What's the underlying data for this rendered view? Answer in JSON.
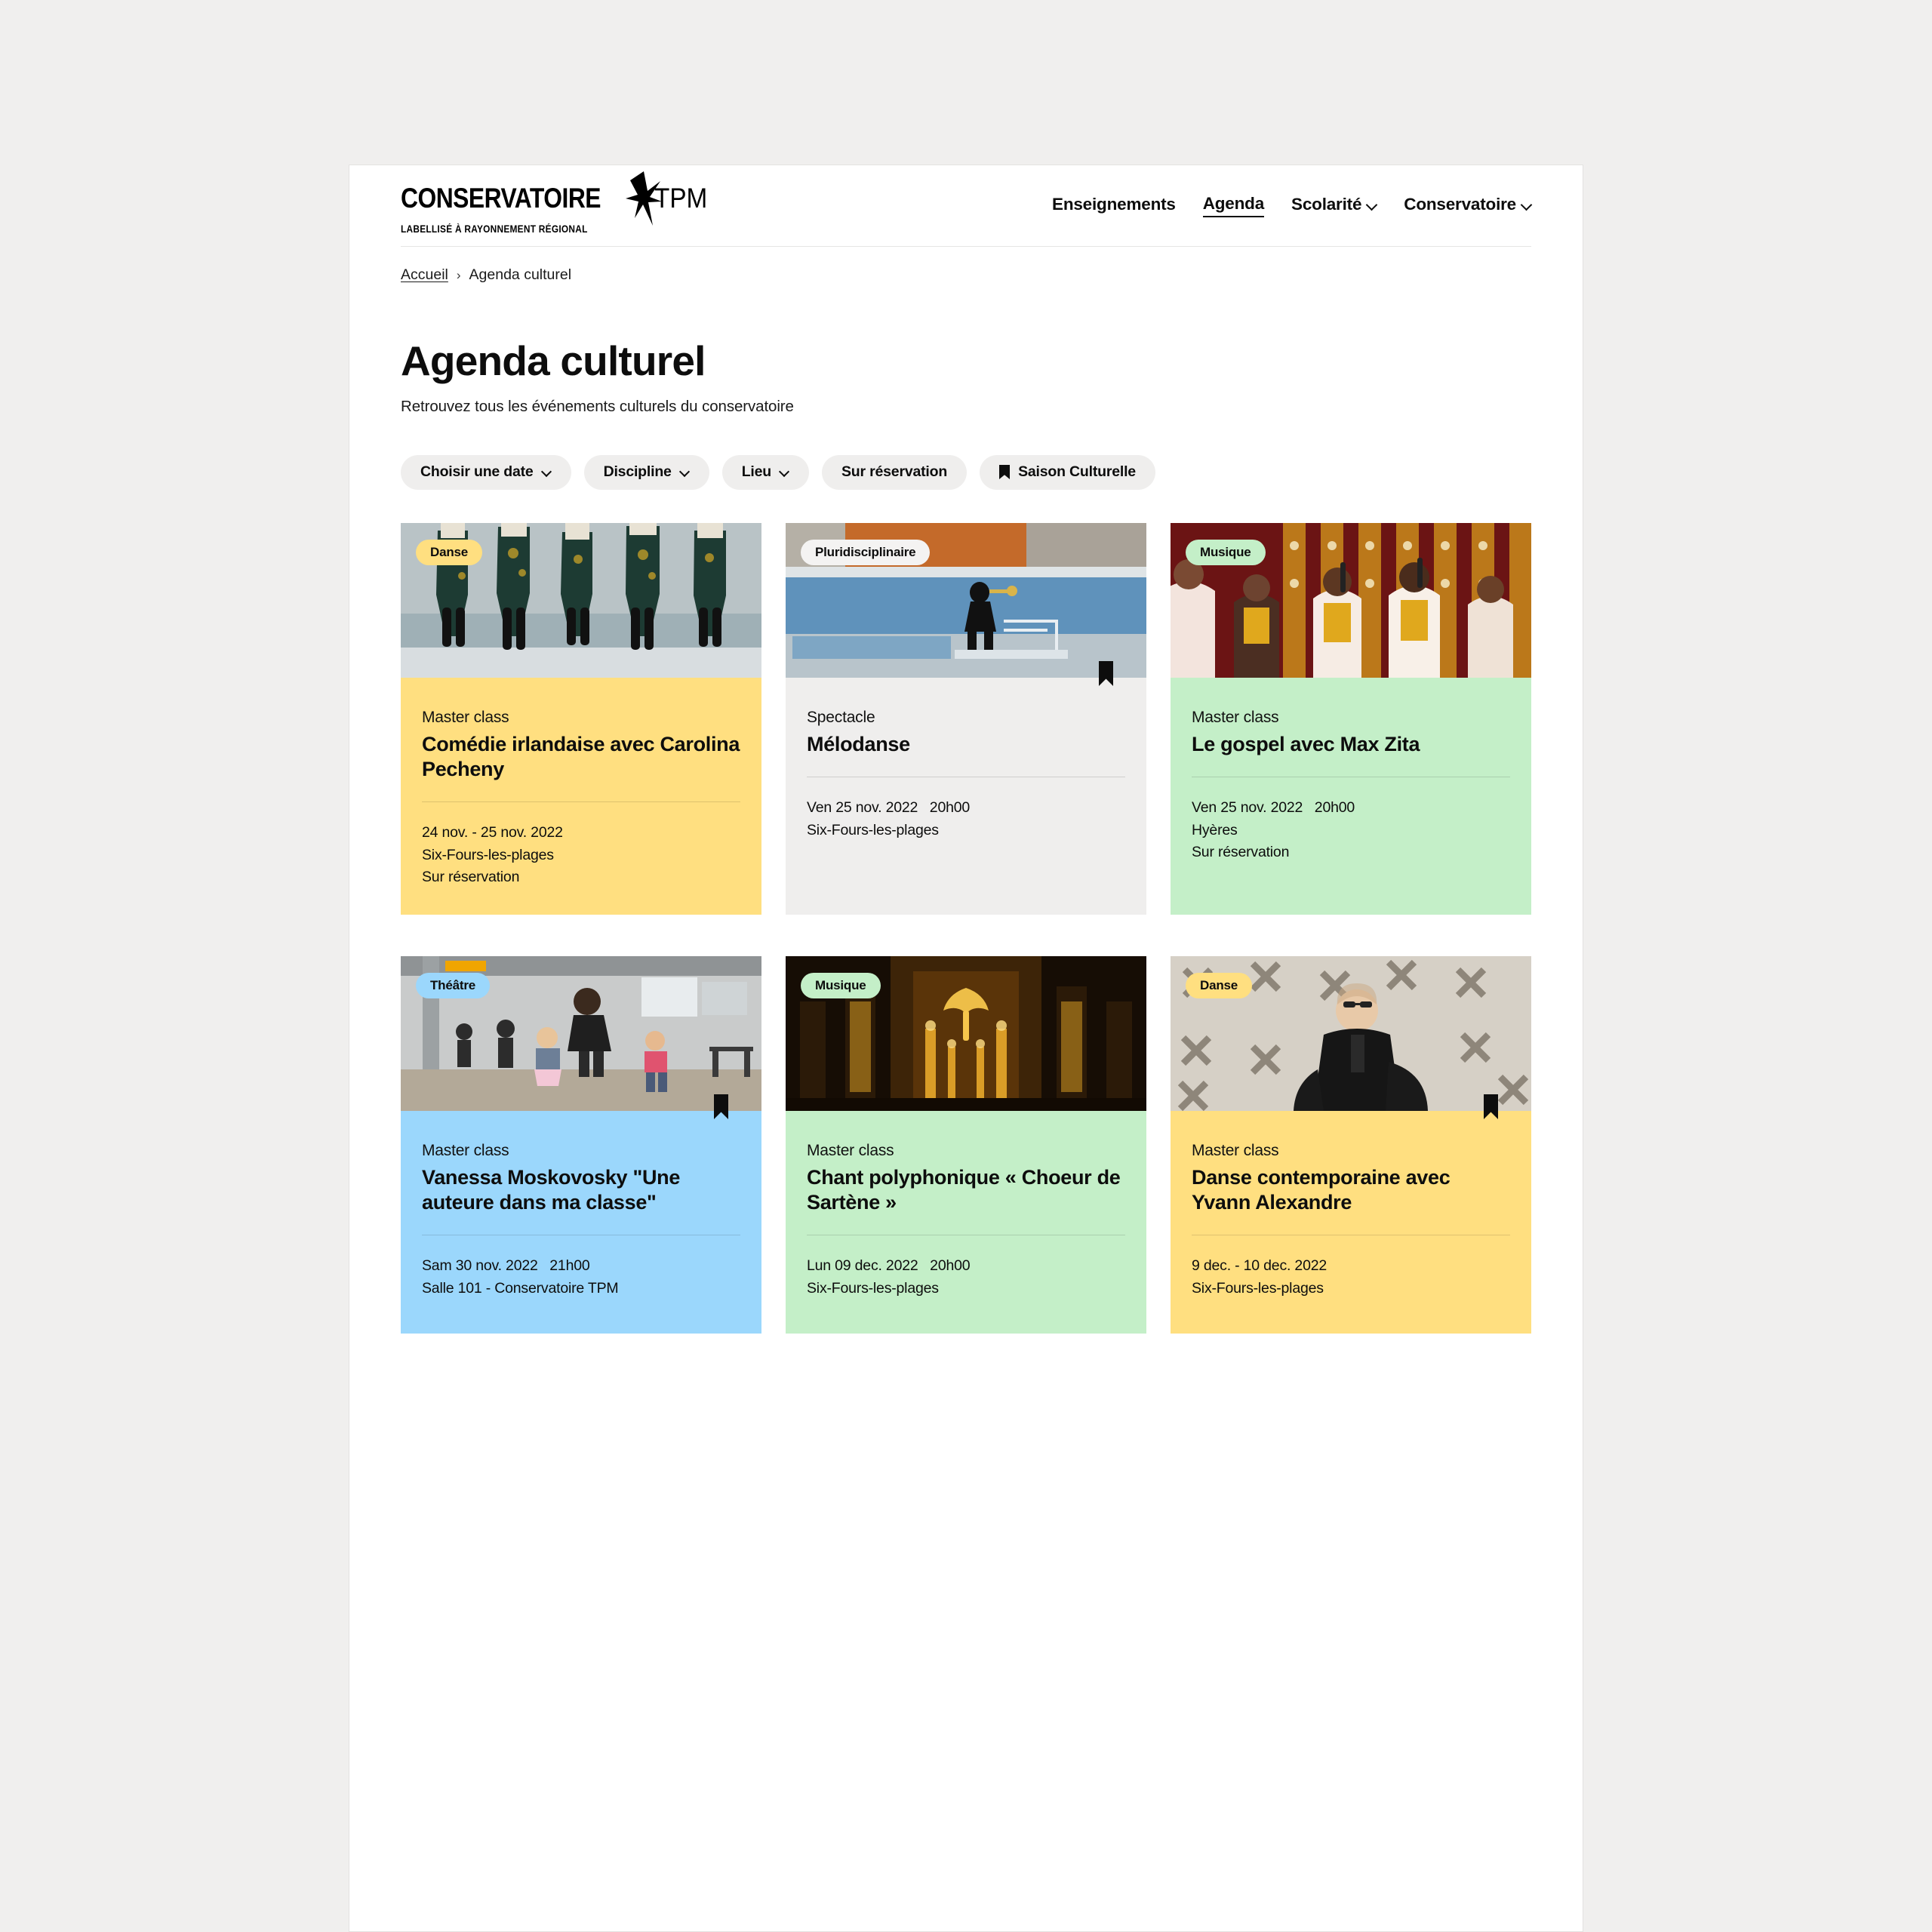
{
  "site": {
    "logo_main": "CONSERVATOIRE",
    "logo_tpm": "TPM",
    "logo_tagline": "LABELLISÉ À RAYONNEMENT RÉGIONAL",
    "logo_star_icon": "star-icon"
  },
  "nav": {
    "items": [
      {
        "label": "Enseignements",
        "has_chevron": false,
        "active": false
      },
      {
        "label": "Agenda",
        "has_chevron": false,
        "active": true
      },
      {
        "label": "Scolarité",
        "has_chevron": true,
        "active": false
      },
      {
        "label": "Conservatoire",
        "has_chevron": true,
        "active": false
      }
    ]
  },
  "breadcrumb": {
    "home": "Accueil",
    "separator": "›",
    "current": "Agenda culturel"
  },
  "page": {
    "title": "Agenda culturel",
    "subtitle": "Retrouvez tous les événements culturels du conservatoire"
  },
  "filters": [
    {
      "label": "Choisir une date",
      "chevron": true,
      "icon": null
    },
    {
      "label": "Discipline",
      "chevron": true,
      "icon": null
    },
    {
      "label": "Lieu",
      "chevron": true,
      "icon": null
    },
    {
      "label": "Sur réservation",
      "chevron": false,
      "icon": null
    },
    {
      "label": "Saison Culturelle",
      "chevron": false,
      "icon": "bookmark-icon"
    }
  ],
  "colors": {
    "yellow": "#FFDF80",
    "green": "#C4EFC8",
    "blue": "#9BD7FC",
    "grey": "#EFEEED",
    "white_badge": "#F4F3F2",
    "page_bg": "#F0EFEE",
    "text": "#0D0D0D"
  },
  "events": [
    {
      "badge": "Danse",
      "badge_color": "#FFDF80",
      "body_color": "#FFDF80",
      "kicker": "Master class",
      "title": "Comédie irlandaise avec Carolina Pecheny",
      "date": "24 nov. - 25 nov. 2022",
      "place": "Six-Fours-les-plages",
      "extra": "Sur réservation",
      "bookmarked": false,
      "image": "irish-dancers-photo"
    },
    {
      "badge": "Pluridisciplinaire",
      "badge_color": "#F4F3F2",
      "body_color": "#EFEEED",
      "kicker": "Spectacle",
      "title": "Mélodanse",
      "date": "Ven 25 nov. 2022   20h00",
      "place": "Six-Fours-les-plages",
      "extra": "",
      "bookmarked": true,
      "image": "trumpet-player-pool-photo"
    },
    {
      "badge": "Musique",
      "badge_color": "#C4EFC8",
      "body_color": "#C4EFC8",
      "kicker": "Master class",
      "title": "Le gospel avec Max Zita",
      "date": "Ven 25 nov. 2022   20h00",
      "place": "Hyères",
      "extra": "Sur réservation",
      "bookmarked": false,
      "image": "gospel-choir-photo"
    },
    {
      "badge": "Théâtre",
      "badge_color": "#9BD7FC",
      "body_color": "#9BD7FC",
      "kicker": "Master class",
      "title": "Vanessa Moskovosky \"Une auteure dans ma classe\"",
      "date": "Sam 30 nov. 2022   21h00",
      "place": "Salle 101 - Conservatoire TPM",
      "extra": "",
      "bookmarked": true,
      "image": "theatre-workshop-photo"
    },
    {
      "badge": "Musique",
      "badge_color": "#C4EFC8",
      "body_color": "#C4EFC8",
      "kicker": "Master class",
      "title": "Chant polyphonique « Choeur de Sartène »",
      "date": "Lun 09 dec. 2022   20h00",
      "place": "Six-Fours-les-plages",
      "extra": "",
      "bookmarked": false,
      "image": "church-interior-photo"
    },
    {
      "badge": "Danse",
      "badge_color": "#FFDF80",
      "body_color": "#FFDF80",
      "kicker": "Master class",
      "title": "Danse contemporaine avec Yvann Alexandre",
      "date": "9 dec. - 10 dec. 2022",
      "place": "Six-Fours-les-plages",
      "extra": "",
      "bookmarked": true,
      "image": "dancer-portrait-photo"
    }
  ]
}
